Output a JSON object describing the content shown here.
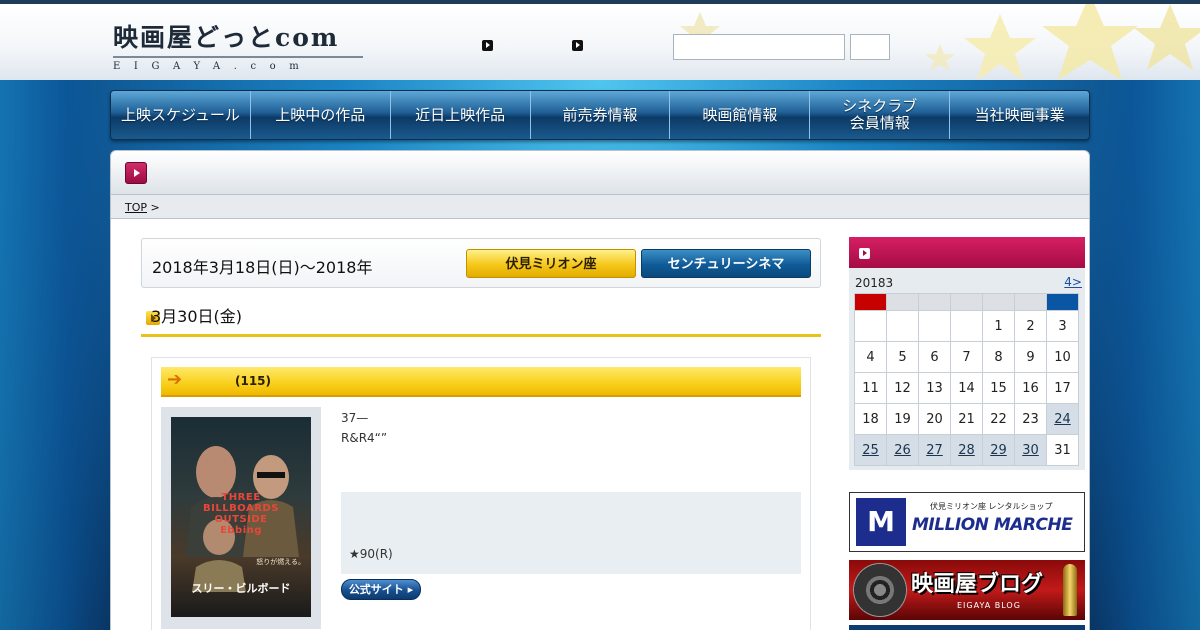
{
  "header": {
    "logo_main": "映画屋どっとcom",
    "logo_sub": "EIGAYA.com",
    "search_placeholder": ""
  },
  "nav": {
    "items": [
      {
        "label": "上映スケジュール"
      },
      {
        "label": "上映中の作品"
      },
      {
        "label": "近日上映作品"
      },
      {
        "label": "前売券情報"
      },
      {
        "label": "映画館情報"
      },
      {
        "label": "シネクラブ\n会員情報"
      },
      {
        "label": "当社映画事業"
      }
    ]
  },
  "breadcrumb": {
    "top": "TOP",
    "sep": ">"
  },
  "schedule": {
    "date_range": "2018年3月18日(日)〜2018年",
    "date_end": "3月30日(金)",
    "theater_1": "伏見ミリオン座",
    "theater_2": "センチュリーシネマ"
  },
  "film": {
    "runtime": "(115)",
    "desc": "37—\nR&R4“”",
    "rating": "★90(R)",
    "official_button": "公式サイト",
    "poster_title": "THREE\nBILLBOARDS\nOUTSIDE\nEbbing",
    "poster_jp": "スリー・ビルボード",
    "poster_tag": "怒りが燃える。"
  },
  "calendar": {
    "month": "20183",
    "next_link": "4>",
    "weeks": [
      [
        "",
        "",
        "",
        "",
        "1",
        "2",
        "3"
      ],
      [
        "4",
        "5",
        "6",
        "7",
        "8",
        "9",
        "10"
      ],
      [
        "11",
        "12",
        "13",
        "14",
        "15",
        "16",
        "17"
      ],
      [
        "18",
        "19",
        "20",
        "21",
        "22",
        "23",
        "24"
      ],
      [
        "25",
        "26",
        "27",
        "28",
        "29",
        "30",
        "31"
      ]
    ],
    "linked_days": [
      "24",
      "25",
      "26",
      "27",
      "28",
      "29",
      "30"
    ]
  },
  "banners": {
    "million_small": "伏見ミリオン座 レンタルショップ",
    "million_big": "MILLION MARCHE",
    "blog_title": "映画屋ブログ",
    "blog_sub": "EIGAYA BLOG"
  },
  "colors": {
    "accent_pink": "#a50c45",
    "nav_blue": "#0d3a66",
    "gold": "#f5c71a"
  }
}
